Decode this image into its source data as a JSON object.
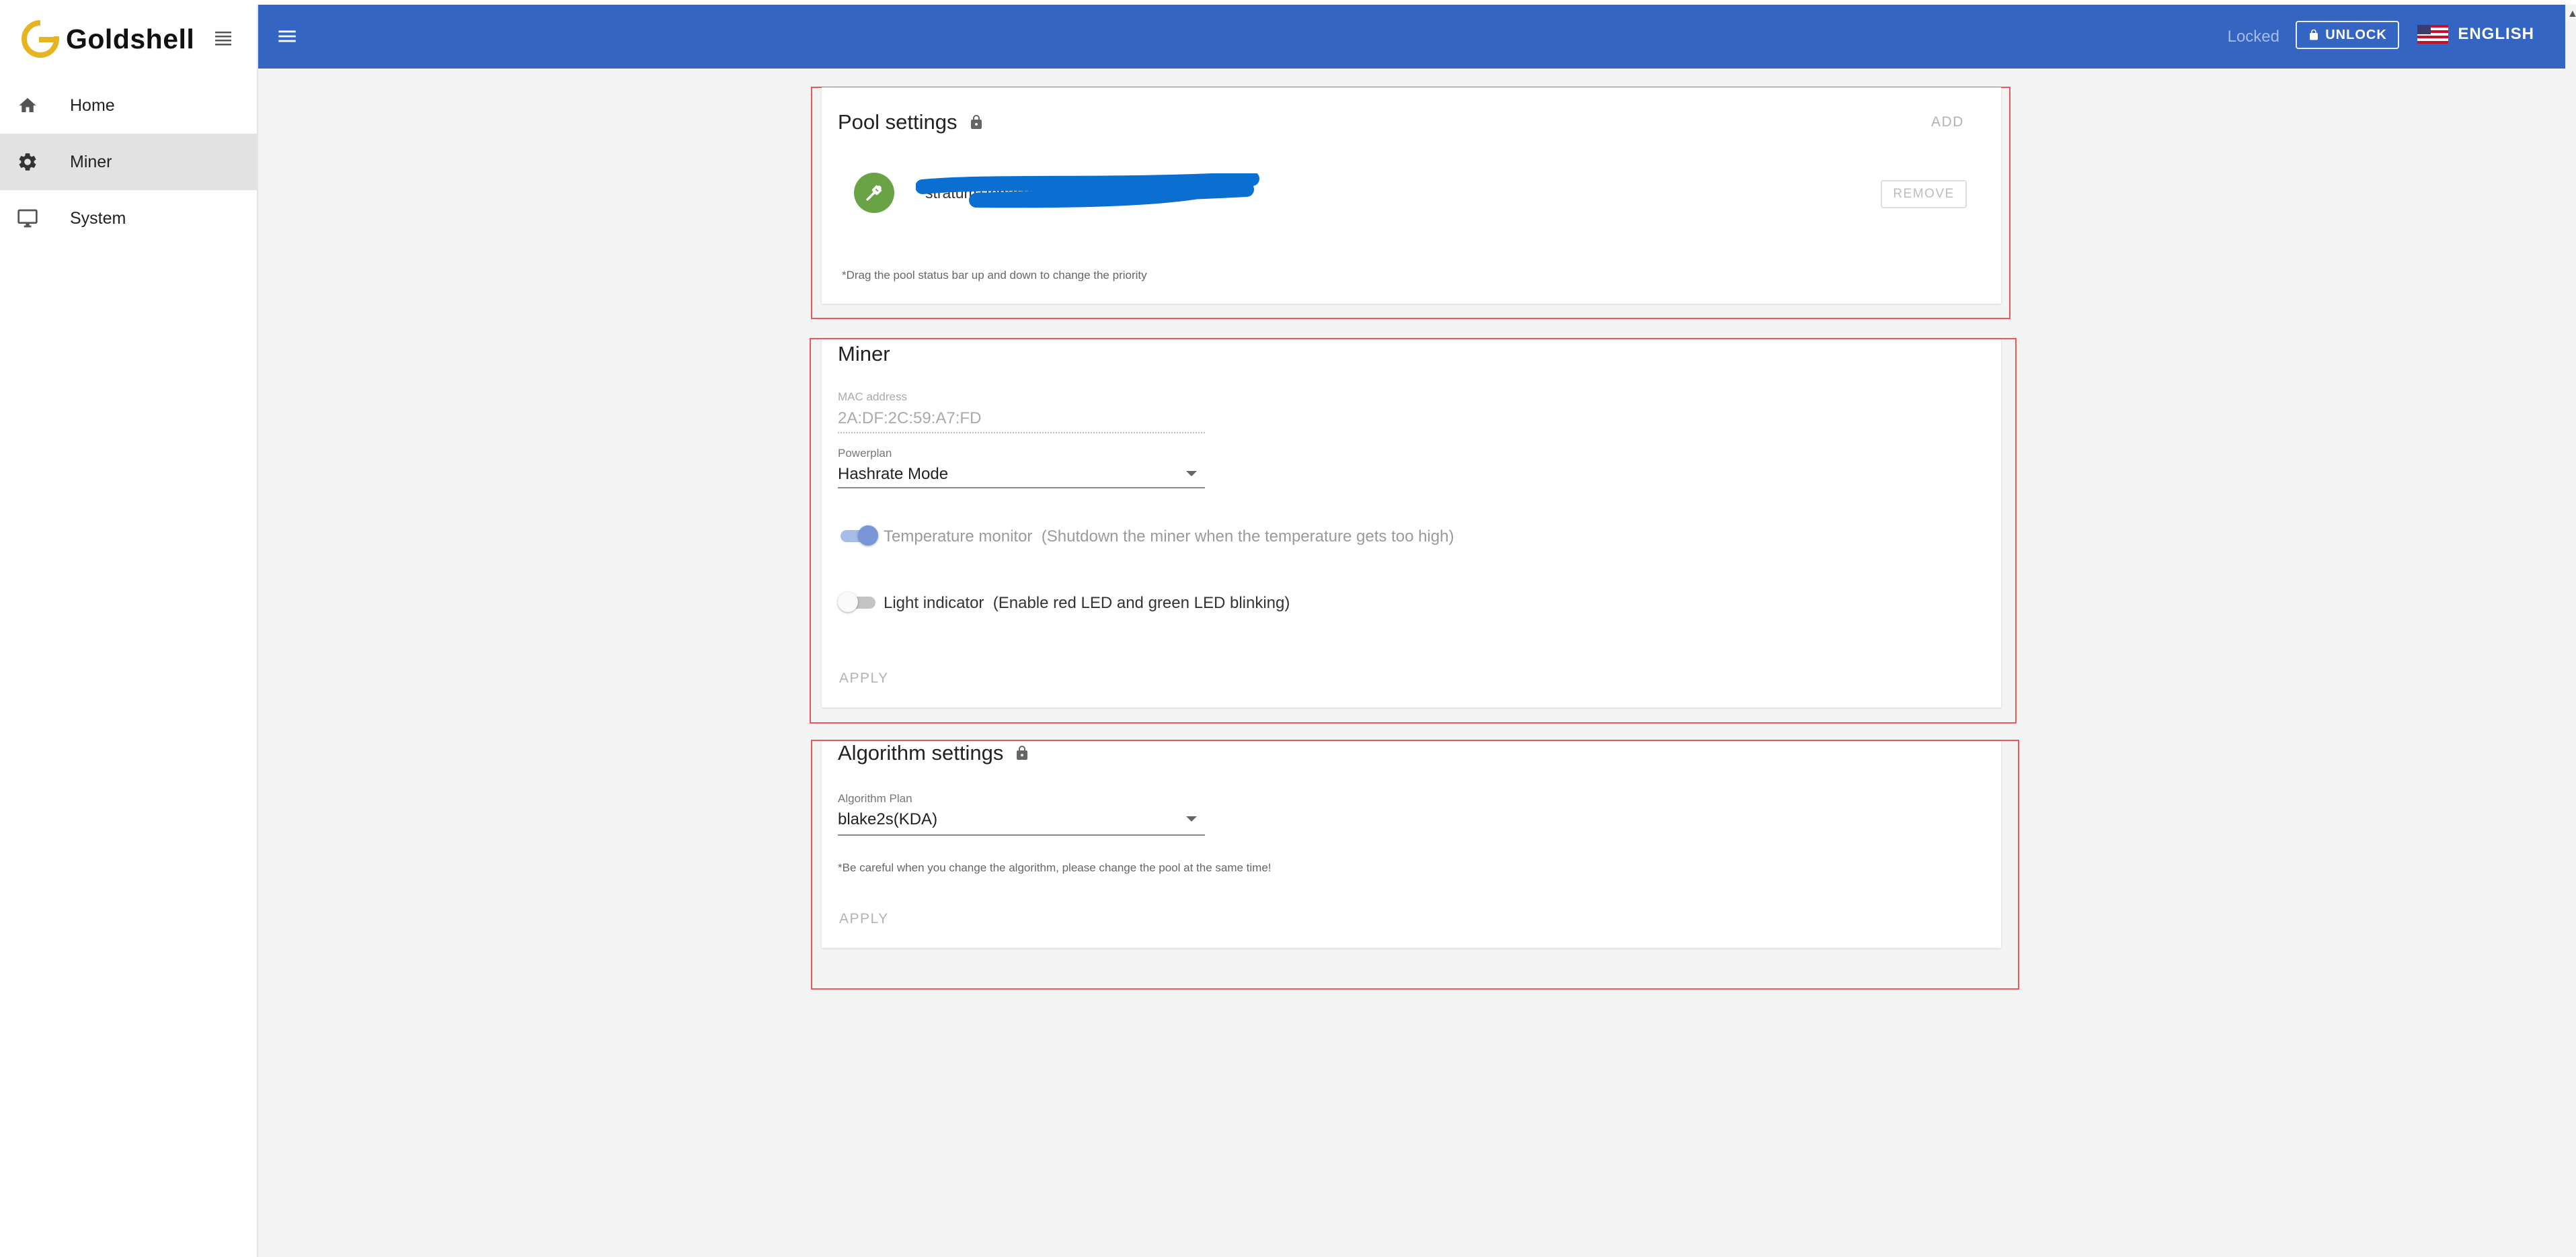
{
  "brand": {
    "name": "Goldshell"
  },
  "sidebar": {
    "items": [
      {
        "label": "Home",
        "icon": "home-icon",
        "active": false
      },
      {
        "label": "Miner",
        "icon": "gear-icon",
        "active": true
      },
      {
        "label": "System",
        "icon": "monitor-icon",
        "active": false
      }
    ]
  },
  "header": {
    "locked_text": "Locked",
    "unlock_label": "UNLOCK",
    "language": "ENGLISH"
  },
  "pool_settings": {
    "title": "Pool settings",
    "add_label": "ADD",
    "pool_url": "stratum+tcp://192.168.111.200:3333",
    "remove_label": "REMOVE",
    "hint": "*Drag the pool status bar up and down to change the priority"
  },
  "miner": {
    "title": "Miner",
    "mac_label": "MAC address",
    "mac_value": "2A:DF:2C:59:A7:FD",
    "powerplan_label": "Powerplan",
    "powerplan_value": "Hashrate Mode",
    "temp_monitor_label": "Temperature monitor  (Shutdown the miner when the temperature gets too high)",
    "temp_monitor_on": true,
    "light_indicator_label": "Light indicator  (Enable red LED and green LED blinking)",
    "light_indicator_on": false,
    "apply_label": "APPLY"
  },
  "algorithm": {
    "title": "Algorithm settings",
    "plan_label": "Algorithm Plan",
    "plan_value": "blake2s(KDA)",
    "warning": "*Be careful when you change the algorithm, please change the pool at the same time!",
    "apply_label": "APPLY"
  },
  "colors": {
    "header": "#3465c2",
    "pool_status": "#6aa246",
    "highlight_frame": "#ea5a5a",
    "redaction": "#0b6fd1"
  }
}
